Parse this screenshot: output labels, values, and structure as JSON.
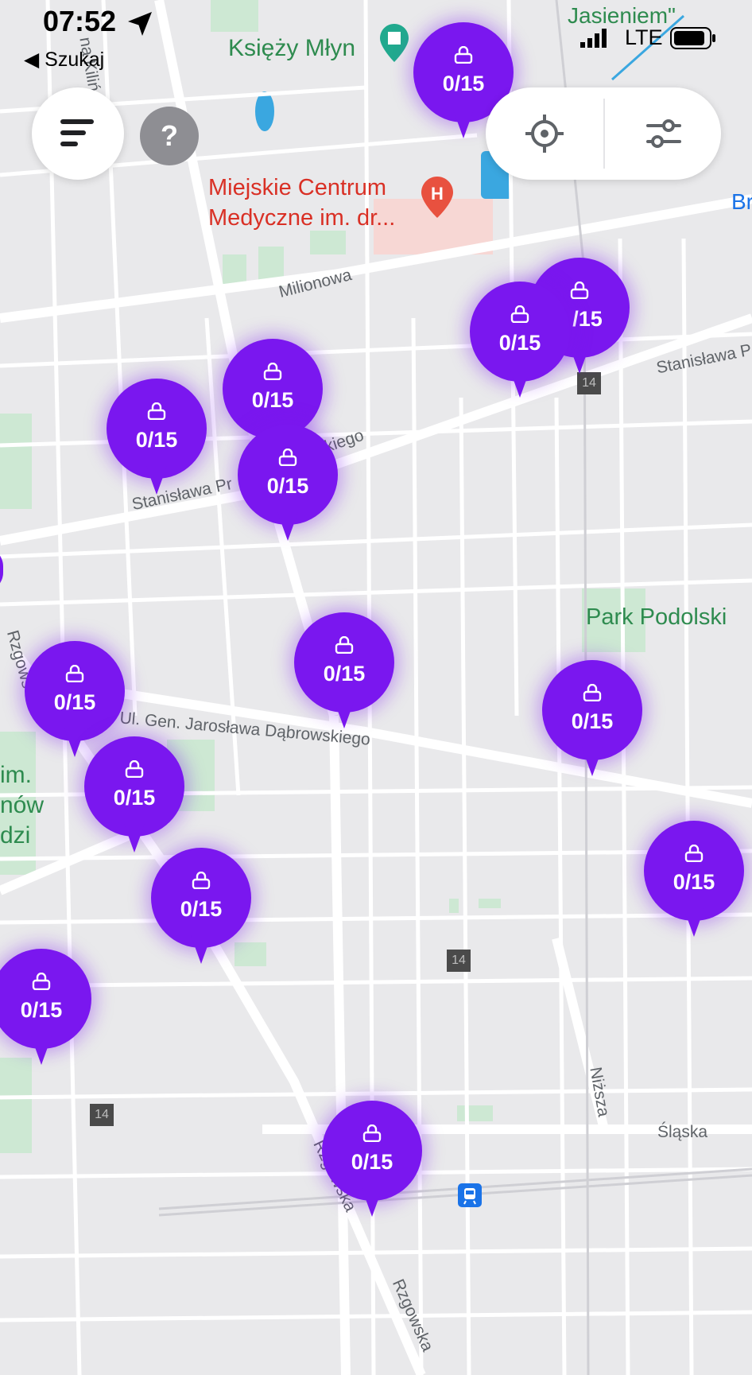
{
  "status_bar": {
    "time": "07:52",
    "back_label": "◀ Szukaj",
    "network": "LTE"
  },
  "controls": {
    "help_label": "?"
  },
  "map": {
    "pois": {
      "ksiezy_mlyn": "Księży Młyn",
      "jasieniem": "Jasieniem\"",
      "hospital_line1": "Miejskie Centrum",
      "hospital_line2": "Medyczne im. dr...",
      "park_podolski": "Park Podolski",
      "im_fragment_1": "im.",
      "im_fragment_2": "nów",
      "im_fragment_3": "dzi",
      "br_fragment": "Br"
    },
    "streets": {
      "milionowa": "Milionowa",
      "stanislawa_top_right": "Stanisława P",
      "stanislawa_left": "Stanisława Pr",
      "kiego": "kiego",
      "dabrowskiego": "Ul. Gen. Jarosława Dąbrowskiego",
      "kilinskiego": "na Kilińskiego",
      "rzgowska_1": "Rzgowska",
      "rzgowska_2": "Rzgowska",
      "nizsza": "Niższa",
      "slaska": "Śląska",
      "rzgows_fragment": "Rzgows"
    },
    "road_badges": [
      "14",
      "14",
      "14"
    ],
    "pin_label": "0/15",
    "pin_label_partial": "/15"
  },
  "colors": {
    "pin": "#7a17ef",
    "map_background": "#e9e9eb",
    "park": "#cde8d3",
    "road": "#ffffff"
  }
}
